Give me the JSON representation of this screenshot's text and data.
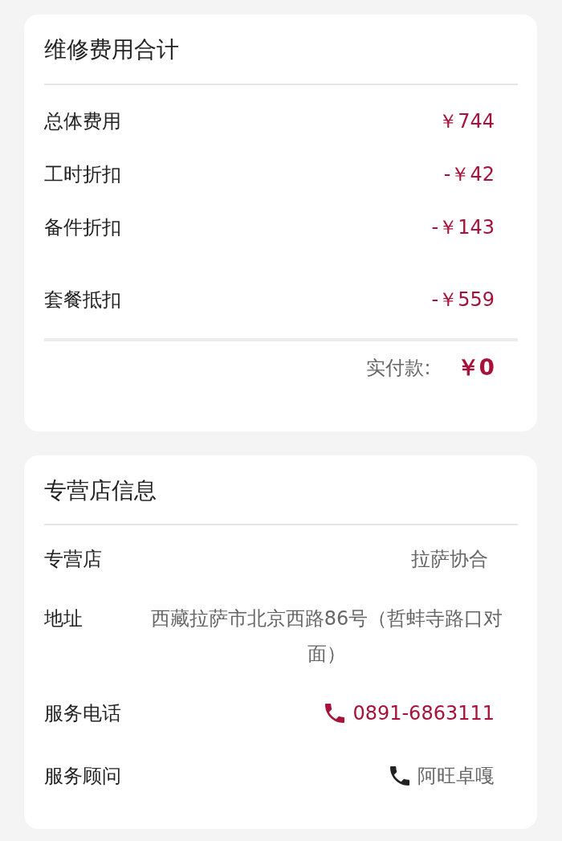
{
  "cost_summary": {
    "title": "维修费用合计",
    "rows": [
      {
        "label": "总体费用",
        "value": "￥744"
      },
      {
        "label": "工时折扣",
        "value": "-￥42"
      },
      {
        "label": "备件折扣",
        "value": "-￥143"
      },
      {
        "label": "套餐抵扣",
        "value": "-￥559"
      }
    ],
    "total": {
      "label": "实付款:",
      "value": "￥0"
    }
  },
  "store_info": {
    "title": "专营店信息",
    "rows": [
      {
        "kind": "text",
        "label": "专营店",
        "value": "拉萨协合"
      },
      {
        "kind": "address",
        "label": "地址",
        "value": "西藏拉萨市北京西路86号（哲蚌寺路口对面）"
      },
      {
        "kind": "phone-link",
        "label": "服务电话",
        "value": "0891-6863111"
      },
      {
        "kind": "phone",
        "label": "服务顾问",
        "value": "阿旺卓嘎"
      }
    ]
  }
}
